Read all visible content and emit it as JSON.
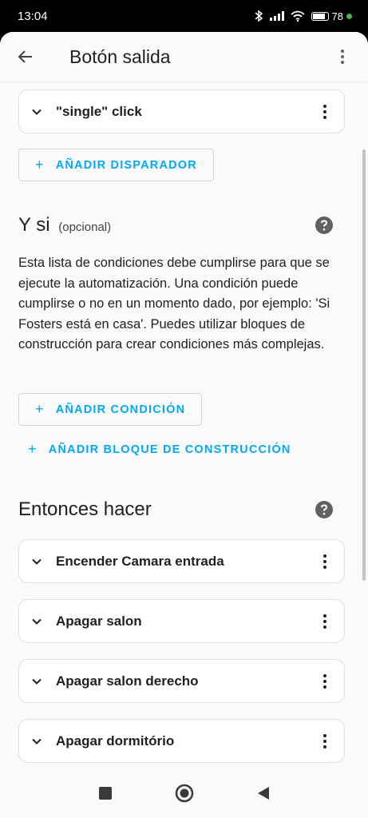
{
  "status_bar": {
    "time": "13:04",
    "battery_text": "78",
    "battery_level": 0.78,
    "icons": [
      "bluetooth-icon",
      "signal-icon",
      "wifi-icon",
      "battery-icon"
    ]
  },
  "app_bar": {
    "title": "Botón salida",
    "icons": [
      "back-arrow-icon",
      "more-vert-icon"
    ]
  },
  "triggers": {
    "items": [
      {
        "label": "\"single\" click"
      }
    ],
    "add_label": "AÑADIR DISPARADOR"
  },
  "conditions": {
    "title": "Y si",
    "optional": "(opcional)",
    "description": "Esta lista de condiciones debe cumplirse para que se ejecute la automatización. Una condición puede cumplirse o no en un momento dado, por ejemplo: 'Si Fosters está en casa'. Puedes utilizar bloques de construcción para crear condiciones más complejas.",
    "add_condition_label": "AÑADIR CONDICIÓN",
    "add_block_label": "AÑADIR BLOQUE DE CONSTRUCCIÓN"
  },
  "actions": {
    "title": "Entonces hacer",
    "items": [
      {
        "label": "Encender Camara entrada"
      },
      {
        "label": "Apagar salon"
      },
      {
        "label": "Apagar salon derecho"
      },
      {
        "label": "Apagar dormitório"
      }
    ]
  },
  "colors": {
    "accent": "#03a9f4",
    "help_icon": "#616161",
    "charging": "#4caf50"
  }
}
